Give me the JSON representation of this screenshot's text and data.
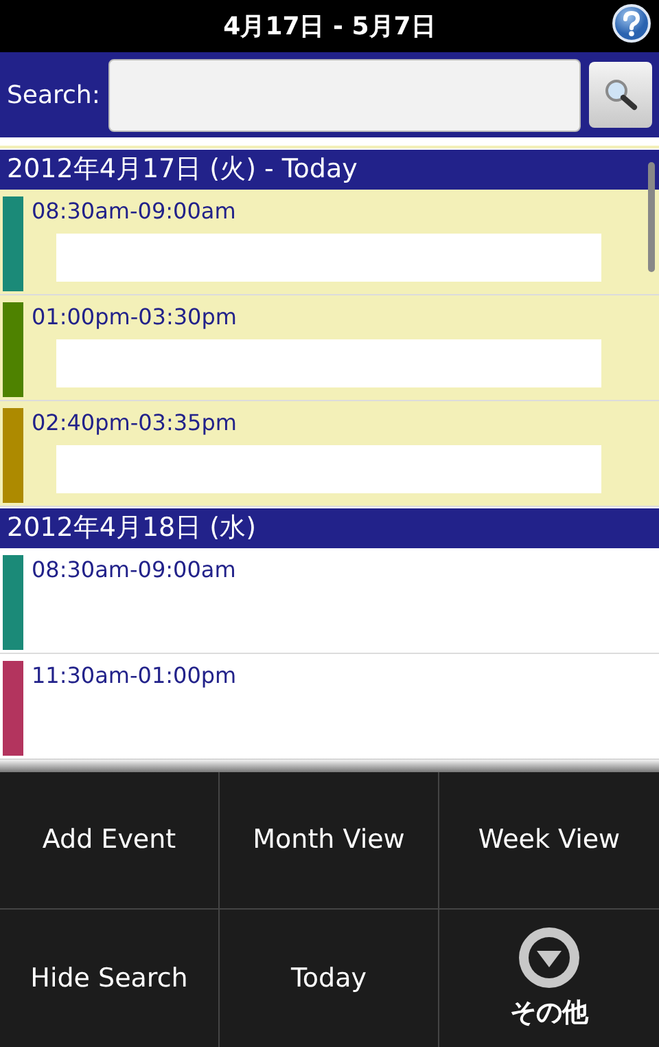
{
  "title_bar": {
    "title": "4月17日 - 5月7日"
  },
  "search": {
    "label": "Search:"
  },
  "days": [
    {
      "heading": "2012年4月17日 (火) - Today",
      "today": true,
      "events": [
        {
          "time": "08:30am-09:00am",
          "color": "#1b8a78"
        },
        {
          "time": "01:00pm-03:30pm",
          "color": "#4e8200"
        },
        {
          "time": "02:40pm-03:35pm",
          "color": "#ad8a00"
        }
      ]
    },
    {
      "heading": "2012年4月18日 (水)",
      "today": false,
      "events": [
        {
          "time": "08:30am-09:00am",
          "color": "#1b8a78"
        },
        {
          "time": "11:30am-01:00pm",
          "color": "#b3345e"
        }
      ]
    }
  ],
  "menu": [
    {
      "kind": "text",
      "label": "Add Event"
    },
    {
      "kind": "text",
      "label": "Month View"
    },
    {
      "kind": "text",
      "label": "Week View"
    },
    {
      "kind": "text",
      "label": "Hide Search"
    },
    {
      "kind": "text",
      "label": "Today"
    },
    {
      "kind": "more",
      "label": "その他"
    }
  ]
}
